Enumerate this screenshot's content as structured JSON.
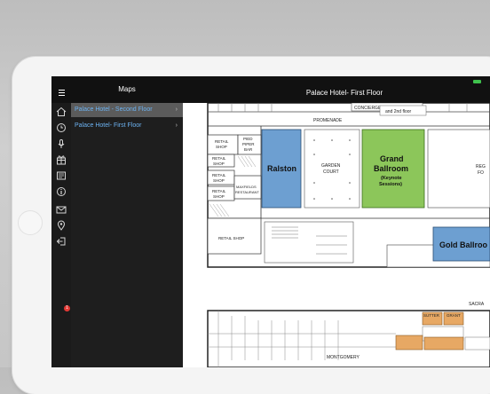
{
  "header": {
    "panel_title": "Maps",
    "map_title": "Palace Hotel- First Floor"
  },
  "floors": [
    {
      "label": "Palace Hotel - Second Floor",
      "selected": true
    },
    {
      "label": "Palace Hotel- First Floor",
      "selected": false
    }
  ],
  "sidebar_icons": [
    {
      "name": "home-icon"
    },
    {
      "name": "clock-icon"
    },
    {
      "name": "microphone-icon"
    },
    {
      "name": "gift-icon"
    },
    {
      "name": "newspaper-icon"
    },
    {
      "name": "info-icon"
    },
    {
      "name": "mail-icon",
      "badge": "1"
    },
    {
      "name": "location-pin-icon"
    },
    {
      "name": "sign-out-icon"
    }
  ],
  "map": {
    "concierge": "CONCIERGE",
    "to_floor": "and 2nd floor",
    "promenade": "PROMENADE",
    "retail_shop": "RETAIL SHOP",
    "retail_shop_1": "RETAIL",
    "retail_shop_1b": "SHOP",
    "retail_shop_2": "RETAIL",
    "retail_shop_2b": "SHOP",
    "retail_shop_3": "RETAIL",
    "retail_shop_3b": "SHOP",
    "retail_shop_4": "RETAIL",
    "retail_shop_4b": "SHOP",
    "pied_piper_1": "PIED",
    "pied_piper_2": "PIPER",
    "pied_piper_3": "BAR",
    "maxfields_1": "MAXFIELDS",
    "maxfields_2": "RESTAURANT",
    "ralston": "Ralston",
    "garden_court_1": "GARDEN",
    "garden_court_2": "COURT",
    "grand_ballroom_1": "Grand",
    "grand_ballroom_2": "Ballroom",
    "keynote_1": "(Keynote",
    "keynote_2": "Sessions)",
    "regency_1": "REG",
    "regency_2": "FO",
    "gold_ballroom": "Gold Ballroo",
    "sacramento": "SACRA",
    "montgomery": "MONTGOMERY",
    "sutter": "SUTTER",
    "grant": "GRANT"
  },
  "colors": {
    "ralston": "#6d9fd1",
    "grand_ballroom": "#8cc65a",
    "gold_ballroom": "#6d9fd1",
    "orange_rooms": "#e7a864"
  }
}
